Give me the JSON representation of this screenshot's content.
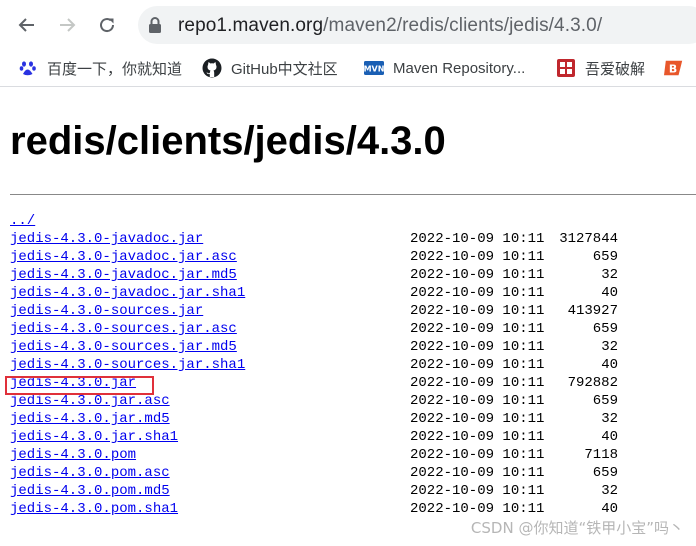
{
  "browser": {
    "url_host": "repo1.maven.org",
    "url_path": "/maven2/redis/clients/jedis/4.3.0/"
  },
  "bookmarks": [
    {
      "label": "百度一下，你就知道",
      "icon": "baidu-paw-icon"
    },
    {
      "label": "GitHub中文社区",
      "icon": "github-icon"
    },
    {
      "label": "Maven Repository...",
      "icon": "mvn-icon"
    },
    {
      "label": "吾爱破解",
      "icon": "52pojie-icon"
    },
    {
      "label": "",
      "icon": "jb-icon"
    }
  ],
  "page": {
    "title": "redis/clients/jedis/4.3.0",
    "parent_link": "../",
    "files": [
      {
        "name": "jedis-4.3.0-javadoc.jar",
        "date": "2022-10-09 10:11",
        "size": "3127844"
      },
      {
        "name": "jedis-4.3.0-javadoc.jar.asc",
        "date": "2022-10-09 10:11",
        "size": "659"
      },
      {
        "name": "jedis-4.3.0-javadoc.jar.md5",
        "date": "2022-10-09 10:11",
        "size": "32"
      },
      {
        "name": "jedis-4.3.0-javadoc.jar.sha1",
        "date": "2022-10-09 10:11",
        "size": "40"
      },
      {
        "name": "jedis-4.3.0-sources.jar",
        "date": "2022-10-09 10:11",
        "size": "413927"
      },
      {
        "name": "jedis-4.3.0-sources.jar.asc",
        "date": "2022-10-09 10:11",
        "size": "659"
      },
      {
        "name": "jedis-4.3.0-sources.jar.md5",
        "date": "2022-10-09 10:11",
        "size": "32"
      },
      {
        "name": "jedis-4.3.0-sources.jar.sha1",
        "date": "2022-10-09 10:11",
        "size": "40"
      },
      {
        "name": "jedis-4.3.0.jar",
        "date": "2022-10-09 10:11",
        "size": "792882"
      },
      {
        "name": "jedis-4.3.0.jar.asc",
        "date": "2022-10-09 10:11",
        "size": "659"
      },
      {
        "name": "jedis-4.3.0.jar.md5",
        "date": "2022-10-09 10:11",
        "size": "32"
      },
      {
        "name": "jedis-4.3.0.jar.sha1",
        "date": "2022-10-09 10:11",
        "size": "40"
      },
      {
        "name": "jedis-4.3.0.pom",
        "date": "2022-10-09 10:11",
        "size": "7118"
      },
      {
        "name": "jedis-4.3.0.pom.asc",
        "date": "2022-10-09 10:11",
        "size": "659"
      },
      {
        "name": "jedis-4.3.0.pom.md5",
        "date": "2022-10-09 10:11",
        "size": "32"
      },
      {
        "name": "jedis-4.3.0.pom.sha1",
        "date": "2022-10-09 10:11",
        "size": "40"
      }
    ]
  },
  "watermark": "CSDN @你知道“铁甲小宝”吗丶",
  "colors": {
    "link": "#0000ee",
    "highlight_box": "#e0303a"
  }
}
